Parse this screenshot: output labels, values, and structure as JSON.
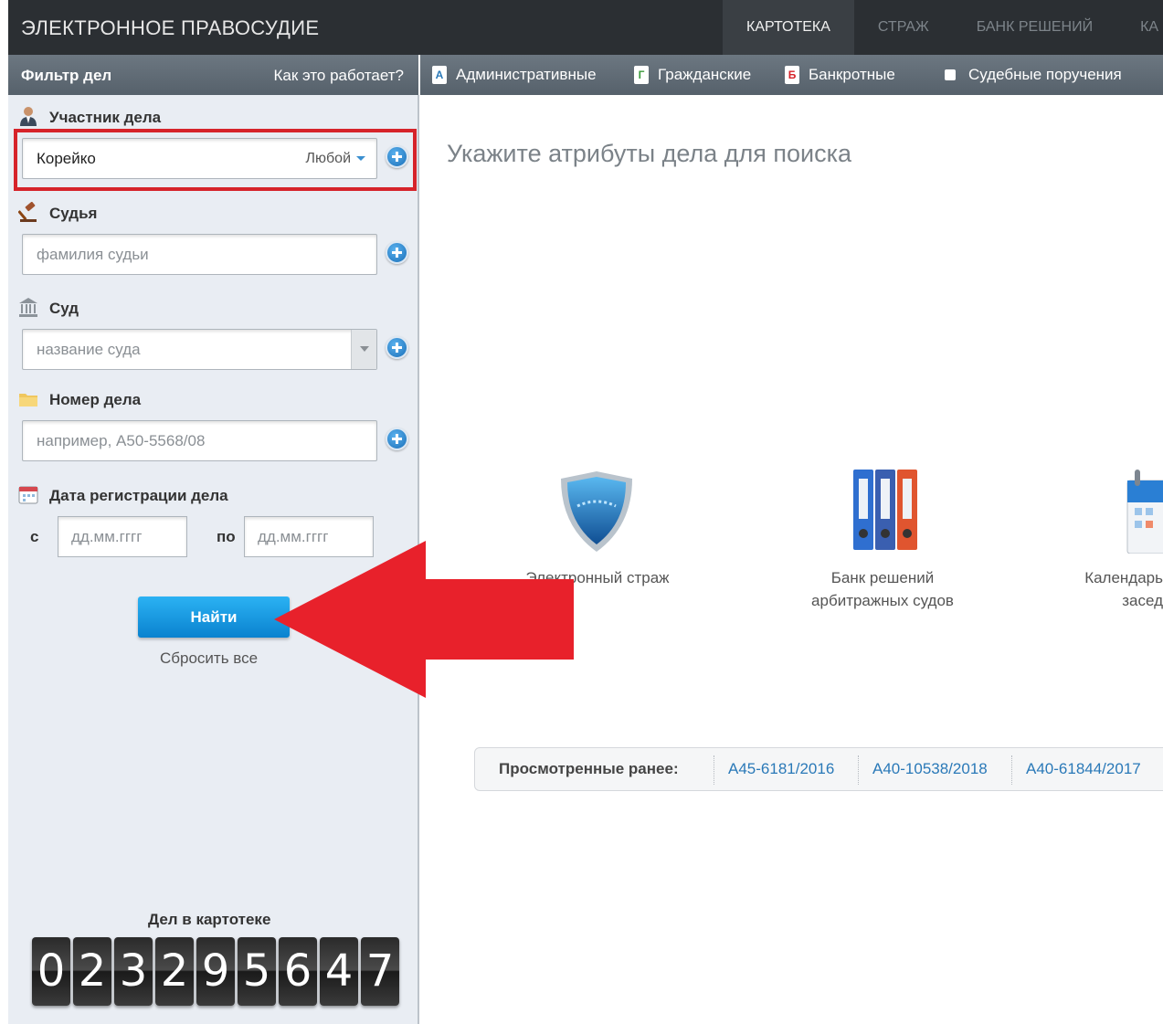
{
  "header": {
    "logo": "ЭЛЕКТРОННОЕ ПРАВОСУДИЕ",
    "tabs": [
      {
        "label": "КАРТОТЕКА",
        "active": true
      },
      {
        "label": "СТРАЖ",
        "active": false
      },
      {
        "label": "БАНК РЕШЕНИЙ",
        "active": false
      },
      {
        "label": "КА",
        "active": false
      }
    ]
  },
  "filter": {
    "title": "Фильтр дел",
    "how_it_works": "Как это работает?"
  },
  "case_types": [
    {
      "icon_letter": "А",
      "label": "Административные",
      "icon": "admin-icon",
      "color": "#2a79b8"
    },
    {
      "icon_letter": "Г",
      "label": "Гражданские",
      "icon": "civil-icon",
      "color": "#3b9a3b"
    },
    {
      "icon_letter": "Б",
      "label": "Банкротные",
      "icon": "bankrupt-icon",
      "color": "#d6232a"
    },
    {
      "icon_letter": "",
      "label": "Судебные поручения",
      "icon": "checkbox-icon",
      "color": "#ffffff"
    }
  ],
  "participant": {
    "label": "Участник дела",
    "value": "Корейко",
    "role": "Любой"
  },
  "judge": {
    "label": "Судья",
    "placeholder": "фамилия судьи"
  },
  "court": {
    "label": "Суд",
    "placeholder": "название суда"
  },
  "case_number": {
    "label": "Номер дела",
    "placeholder": "например, А50-5568/08"
  },
  "reg_date": {
    "label": "Дата регистрации дела",
    "from_label": "с",
    "to_label": "по",
    "from_placeholder": "дд.мм.гггг",
    "to_placeholder": "дд.мм.гггг"
  },
  "actions": {
    "find": "Найти",
    "reset": "Сбросить все"
  },
  "counter": {
    "title": "Дел в картотеке",
    "digits": [
      "0",
      "2",
      "3",
      "2",
      "9",
      "5",
      "6",
      "4",
      "7"
    ]
  },
  "main": {
    "hint": "Укажите атрибуты дела для поиска",
    "tiles": [
      {
        "line1": "Электронный страж",
        "line2": ""
      },
      {
        "line1": "Банк решений",
        "line2": "арбитражных судов"
      },
      {
        "line1": "Календарь",
        "line2": "засед"
      }
    ],
    "recent_label": "Просмотренные ранее:",
    "recent": [
      "А45-6181/2016",
      "А40-10538/2018",
      "А40-61844/2017"
    ]
  },
  "colors": {
    "header_bg": "#2b2f33",
    "bar_bg": "#606b75",
    "accent_blue": "#0a82cf",
    "highlight_red": "#d6232a",
    "annotation_arrow": "#e8212b"
  }
}
